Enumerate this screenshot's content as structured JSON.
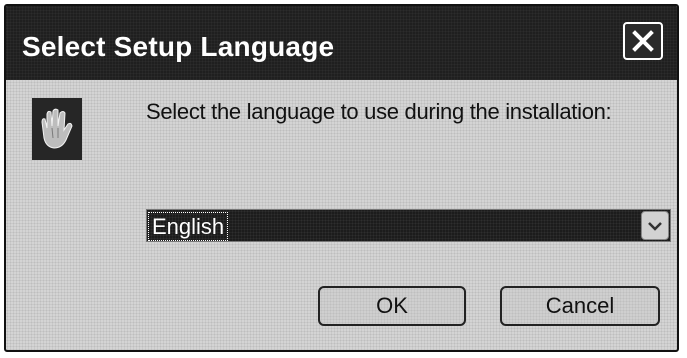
{
  "window": {
    "title": "Select Setup Language",
    "close_icon": "close-icon",
    "app_icon": "setup-hand-icon"
  },
  "prompt": "Select the language to use during the installation:",
  "language_select": {
    "selected": "English",
    "arrow_icon": "chevron-down-icon"
  },
  "buttons": {
    "ok_label": "OK",
    "cancel_label": "Cancel"
  },
  "colors": {
    "titlebar": "#1f1f1f",
    "dialog_background": "#d4d4d4",
    "selection_background": "#1c1c1c"
  }
}
